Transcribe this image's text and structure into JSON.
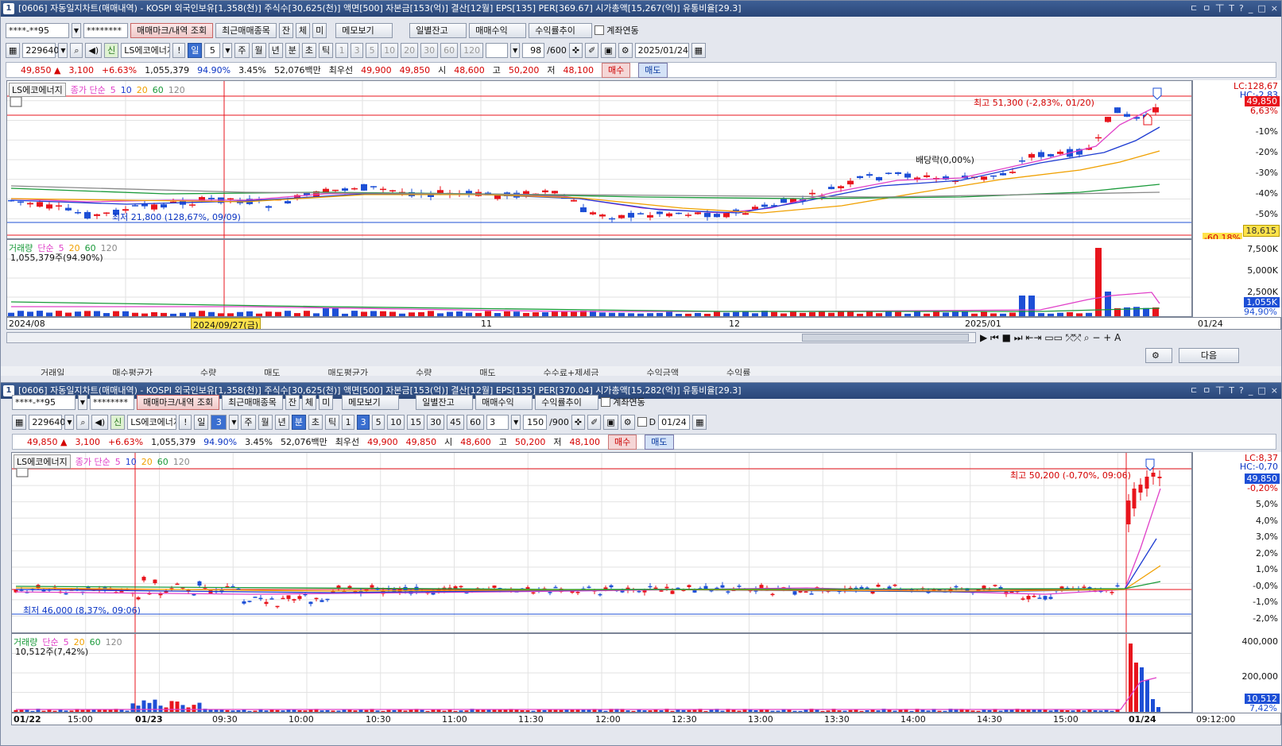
{
  "win1": {
    "title": "[0606] 자동일지차트(매매내역) - KOSPI 외국인보유[1,358(천)] 주식수[30,625(천)] 액면[500] 자본금[153(억)] 결산[12월] EPS[135] PER[369.67] 시가총액[15,267(억)] 유통비율[29.3]",
    "controls": [
      "ㄷ",
      "ㅁ",
      "丅",
      "T",
      "?",
      "_",
      "□",
      "×"
    ],
    "account": "****-**95",
    "password": "********",
    "buttons": {
      "mark": "매매마크/내역 조회",
      "recent": "최근매매종목",
      "jan": "잔",
      "che": "체",
      "mi": "미",
      "memo": "메모보기",
      "daily": "일별잔고",
      "profit": "매매수익",
      "trend": "수익률추이",
      "link": "계좌연동"
    },
    "code": "229640",
    "stock": "LS에코에너지",
    "mode": "일",
    "interval": "5",
    "periods": [
      "주",
      "월",
      "년",
      "분",
      "초",
      "틱"
    ],
    "nums": [
      "1",
      "3",
      "5",
      "10",
      "20",
      "30",
      "60",
      "120"
    ],
    "count": "98",
    "total": "/600",
    "date": "2025/01/24",
    "quote": {
      "price": "49,850 ▲",
      "change": "3,100",
      "rate": "+6.63%",
      "volume": "1,055,379",
      "vr": "94.90%",
      "turn": "3.45%",
      "amount": "52,076백만",
      "bid_label": "최우선",
      "bid1": "49,900",
      "bid2": "49,850",
      "open_l": "시",
      "open": "48,600",
      "high_l": "고",
      "high": "50,200",
      "low_l": "저",
      "low": "48,100",
      "buy": "매수",
      "sell": "매도"
    },
    "legend": {
      "name": "LS에코에너지",
      "ma": "종가 단순",
      "m5": "5",
      "m10": "10",
      "m20": "20",
      "m60": "60",
      "m120": "120"
    },
    "vol_legend": {
      "name": "거래량",
      "ma": "단순",
      "m5": "5",
      "m20": "20",
      "m60": "60",
      "m120": "120",
      "value": "1,055,379주(94.90%)"
    },
    "ann": {
      "high": "최고 51,300 (-2,83%, 01/20)",
      "low": "최저 21,800 (128,67%, 09/09)",
      "div": "배당락(0,00%)"
    },
    "axis": [
      "LC:128,67",
      "HC:-2,83",
      "-10%",
      "-20%",
      "-30%",
      "-40%",
      "-50%"
    ],
    "axis_top": "6,63%",
    "price_tag": "49,850",
    "cross_tag": "18,615",
    "cross_pct": "-60,18%",
    "vol_axis": [
      "7,500K",
      "5,000K",
      "2,500K"
    ],
    "vol_tag": "1,055K",
    "vol_pct": "94,90%",
    "dates": [
      "2024/08",
      "2024/09/27(금)",
      "11",
      "12",
      "2025/01",
      "01/24"
    ],
    "next": "다음",
    "table_headers": [
      "거래일",
      "매수평균가",
      "수량",
      "매도",
      "매도평균가",
      "수량",
      "매도",
      "수수료+제세금",
      "수익금액",
      "수익률"
    ]
  },
  "win2": {
    "title": "[0606] 자동일지차트(매매내역) - KOSPI 외국인보유[1,358(천)] 주식수[30,625(천)] 액면[500] 자본금[153(억)] 결산[12월] EPS[135] PER[370.04] 시가총액[15,282(억)] 유통비율[29.3]",
    "mode": "일",
    "interval": "3",
    "cur": "분",
    "periods1": [
      "주",
      "월",
      "년"
    ],
    "periods2": [
      "초",
      "틱"
    ],
    "nums": [
      "1",
      "3",
      "5",
      "10",
      "15",
      "30",
      "45",
      "60"
    ],
    "sel": "3",
    "count": "150",
    "total": "/900",
    "d_label": "D",
    "date": "01/24",
    "axis": [
      "LC:8,37",
      "HC:-0,70",
      "-0,20%",
      "5,0%",
      "4,0%",
      "3,0%",
      "2,0%",
      "1,0%",
      "-0,0%",
      "-1,0%",
      "-2,0%"
    ],
    "price_tag": "49,850",
    "ann": {
      "high": "최고 50,200 (-0,70%, 09:06)",
      "low": "최저 46,000 (8,37%, 09:06)"
    },
    "vol_legend_value": "10,512주(7,42%)",
    "vol_axis": [
      "400,000",
      "200,000"
    ],
    "vol_tag": "10,512",
    "vol_pct": "7,42%",
    "times": [
      "01/22",
      "15:00",
      "01/23",
      "09:30",
      "10:00",
      "10:30",
      "11:00",
      "11:30",
      "12:00",
      "12:30",
      "13:00",
      "13:30",
      "14:00",
      "14:30",
      "15:00",
      "01/24",
      "09:12:00"
    ]
  },
  "colors": {
    "up": "#e8141c",
    "down": "#1d4fd6",
    "ma5": "#e040c8",
    "ma10": "#1e3cd2",
    "ma20": "#f0a000",
    "ma60": "#1a9a3a",
    "ma120": "#8a8a8a"
  }
}
